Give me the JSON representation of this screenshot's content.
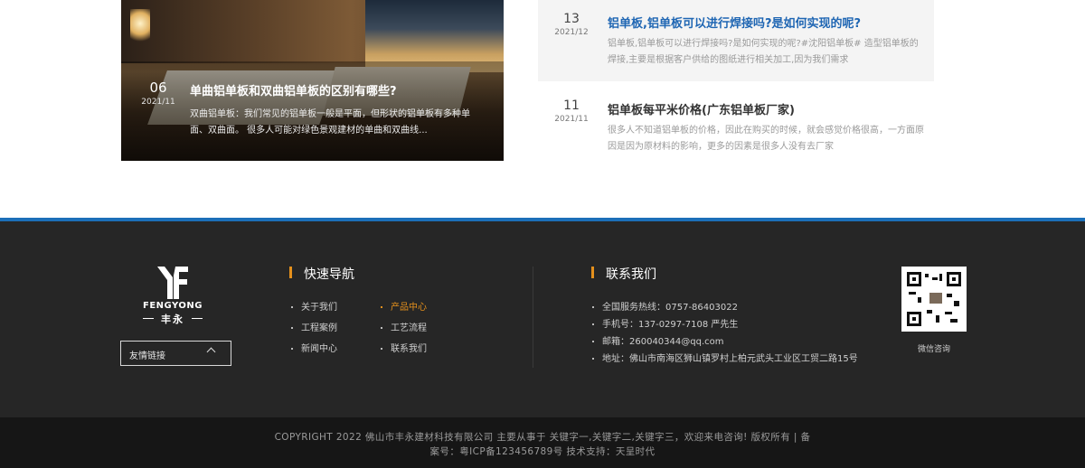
{
  "featured": {
    "day": "06",
    "ym": "2021/11",
    "title": "单曲铝单板和双曲铝单板的区别有哪些?",
    "desc": "双曲铝单板：我们常见的铝单板一般是平面，但形状的铝单板有多种单面、双曲面。 很多人可能对绿色景观建材的单曲和双曲线..."
  },
  "news": [
    {
      "day": "13",
      "ym": "2021/12",
      "title": "铝单板,铝单板可以进行焊接吗?是如何实现的呢?",
      "title_color": "#1f66b3",
      "desc": "铝单板,铝单板可以进行焊接吗?是如何实现的呢?#沈阳铝单板# 造型铝单板的焊接,主要是根据客户供给的图纸进行相关加工,因为我们需求"
    },
    {
      "day": "11",
      "ym": "2021/11",
      "title": "铝单板每平米价格(广东铝单板厂家)",
      "title_color": "#333333",
      "desc": "很多人不知道铝单板的价格，因此在购买的时候，就会感觉价格很高，一方面原因是因为原材料的影响，更多的因素是很多人没有去厂家"
    }
  ],
  "footer": {
    "brand_en": "FENGYONG",
    "brand_cn": "丰永",
    "friend_links": "友情链接",
    "quick_nav_title": "快速导航",
    "nav": [
      {
        "label": "关于我们",
        "active": false
      },
      {
        "label": "产品中心",
        "active": true
      },
      {
        "label": "工程案例",
        "active": false
      },
      {
        "label": "工艺流程",
        "active": false
      },
      {
        "label": "新闻中心",
        "active": false
      },
      {
        "label": "联系我们",
        "active": false
      }
    ],
    "contact_title": "联系我们",
    "contact": [
      "全国服务热线：0757-86403022",
      "手机号：137-0297-7108  严先生",
      "邮箱：260040344@qq.com",
      "地址：佛山市南海区狮山镇罗村上柏元武头工业区工贸二路15号"
    ],
    "qr_label": "微信咨询",
    "copyright_line1": "COPYRIGHT 2022 佛山市丰永建材科技有限公司  主要从事于 关键字一,关键字二,关键字三，欢迎来电咨询!  版权所有 | 备",
    "copyright_line2": "案号：粤ICP备123456789号  技术支持：天呈时代"
  },
  "colors": {
    "accent_blue": "#1c6fb8",
    "accent_orange": "#e4901c",
    "footer_bg": "#262626"
  }
}
